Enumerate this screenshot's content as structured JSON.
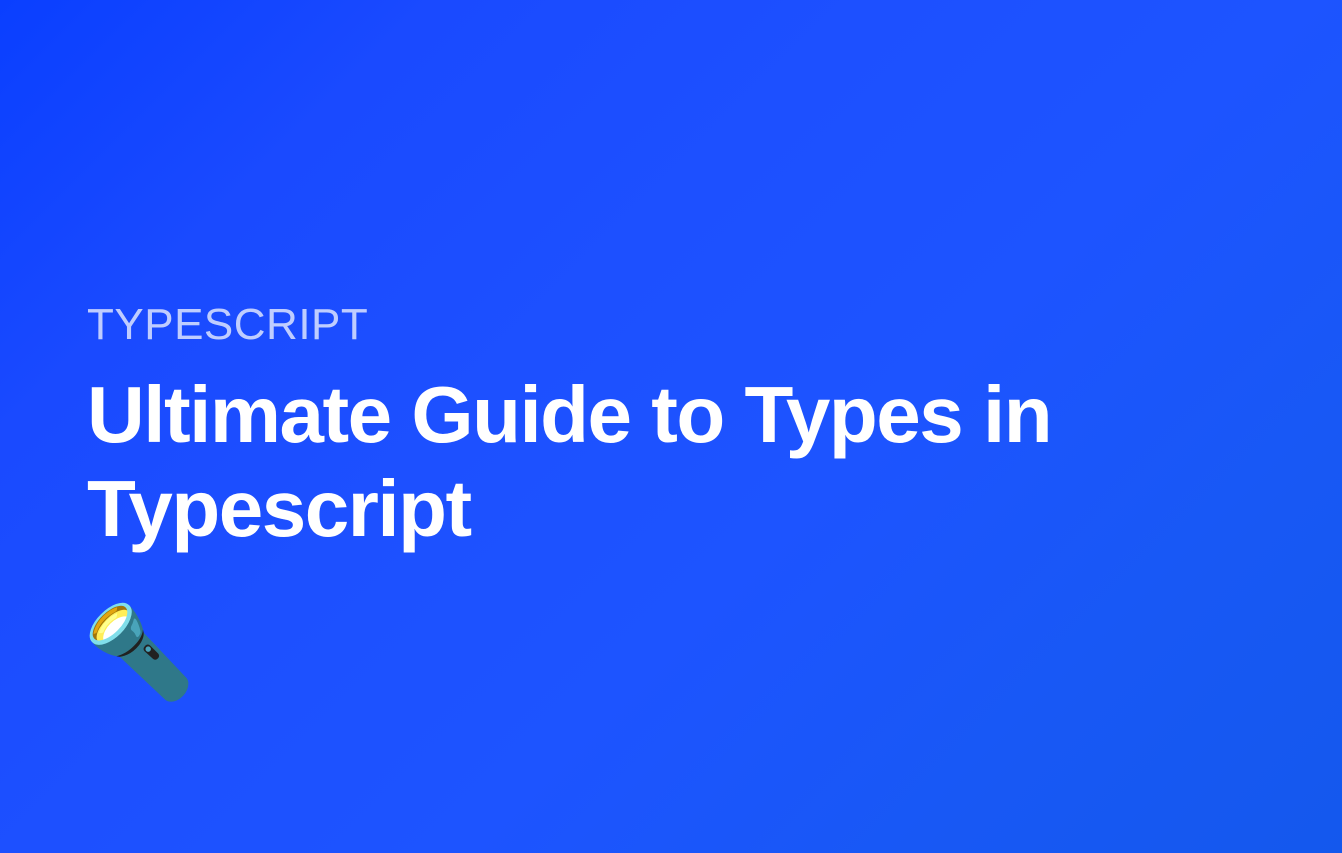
{
  "category": "TYPESCRIPT",
  "title": "Ultimate Guide to Types in Typescript",
  "icon": "🔦"
}
